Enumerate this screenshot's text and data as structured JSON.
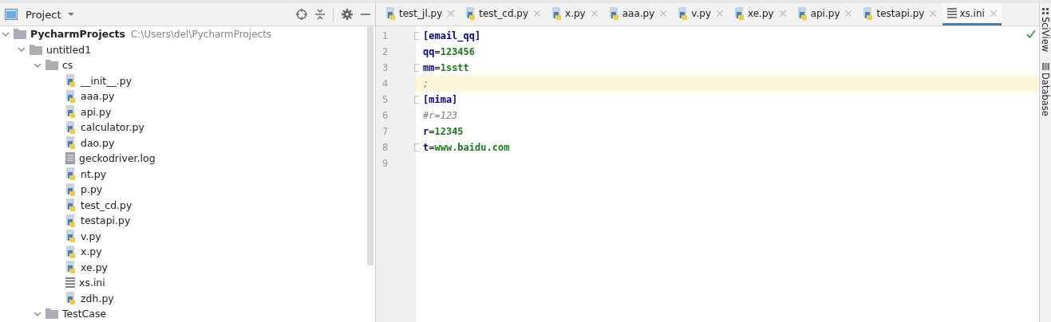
{
  "project_panel": {
    "title": "Project"
  },
  "tree": [
    {
      "label": "PycharmProjects",
      "path": "C:\\Users\\del\\PycharmProjects",
      "kind": "folder",
      "expanded": true,
      "children": [
        {
          "label": "untitled1",
          "kind": "folder",
          "expanded": true,
          "children": [
            {
              "label": "cs",
              "kind": "folder",
              "expanded": true,
              "children": [
                {
                  "label": "__init__.py",
                  "kind": "python"
                },
                {
                  "label": "aaa.py",
                  "kind": "python"
                },
                {
                  "label": "api.py",
                  "kind": "python"
                },
                {
                  "label": "calculator.py",
                  "kind": "python"
                },
                {
                  "label": "dao.py",
                  "kind": "python"
                },
                {
                  "label": "geckodriver.log",
                  "kind": "log"
                },
                {
                  "label": "nt.py",
                  "kind": "python"
                },
                {
                  "label": "p.py",
                  "kind": "python"
                },
                {
                  "label": "test_cd.py",
                  "kind": "python"
                },
                {
                  "label": "testapi.py",
                  "kind": "python"
                },
                {
                  "label": "v.py",
                  "kind": "python"
                },
                {
                  "label": "x.py",
                  "kind": "python"
                },
                {
                  "label": "xe.py",
                  "kind": "python"
                },
                {
                  "label": "xs.ini",
                  "kind": "ini"
                },
                {
                  "label": "zdh.py",
                  "kind": "python"
                }
              ]
            },
            {
              "label": "TestCase",
              "kind": "folder",
              "expanded": true
            }
          ]
        }
      ]
    }
  ],
  "tabs": [
    {
      "label": "test_jl.py",
      "kind": "python",
      "selected": false
    },
    {
      "label": "test_cd.py",
      "kind": "python",
      "selected": false
    },
    {
      "label": "x.py",
      "kind": "python",
      "selected": false
    },
    {
      "label": "aaa.py",
      "kind": "python",
      "selected": false
    },
    {
      "label": "v.py",
      "kind": "python",
      "selected": false
    },
    {
      "label": "xe.py",
      "kind": "python",
      "selected": false
    },
    {
      "label": "api.py",
      "kind": "python",
      "selected": false
    },
    {
      "label": "testapi.py",
      "kind": "python",
      "selected": false
    },
    {
      "label": "xs.ini",
      "kind": "ini",
      "selected": true
    }
  ],
  "editor": {
    "lines": [
      {
        "number": "1",
        "current": false,
        "fold": true,
        "tokens": [
          {
            "text": "[email_qq]",
            "kind": "section"
          }
        ]
      },
      {
        "number": "2",
        "current": false,
        "fold": false,
        "tokens": [
          {
            "text": "qq",
            "kind": "key"
          },
          {
            "text": "=",
            "kind": "op"
          },
          {
            "text": "123456",
            "kind": "value"
          }
        ]
      },
      {
        "number": "3",
        "current": false,
        "fold": true,
        "tokens": [
          {
            "text": "mm",
            "kind": "key"
          },
          {
            "text": "=",
            "kind": "op"
          },
          {
            "text": "1sstt",
            "kind": "value"
          }
        ]
      },
      {
        "number": "4",
        "current": true,
        "fold": false,
        "tokens": [
          {
            "text": ";",
            "kind": "comment"
          }
        ]
      },
      {
        "number": "5",
        "current": false,
        "fold": true,
        "tokens": [
          {
            "text": "[mima]",
            "kind": "section"
          }
        ]
      },
      {
        "number": "6",
        "current": false,
        "fold": false,
        "tokens": [
          {
            "text": "#r=123",
            "kind": "comment"
          }
        ]
      },
      {
        "number": "7",
        "current": false,
        "fold": false,
        "tokens": [
          {
            "text": "r",
            "kind": "key"
          },
          {
            "text": "=",
            "kind": "op"
          },
          {
            "text": "12345",
            "kind": "value"
          }
        ]
      },
      {
        "number": "8",
        "current": false,
        "fold": true,
        "tokens": [
          {
            "text": "t",
            "kind": "key"
          },
          {
            "text": "=",
            "kind": "op"
          },
          {
            "text": "www.baidu.com",
            "kind": "value"
          }
        ]
      },
      {
        "number": "9",
        "current": false,
        "fold": false
      }
    ]
  },
  "right_tools": [
    {
      "label": "SciView",
      "kind": "sciview"
    },
    {
      "label": "Database",
      "kind": "database"
    }
  ]
}
